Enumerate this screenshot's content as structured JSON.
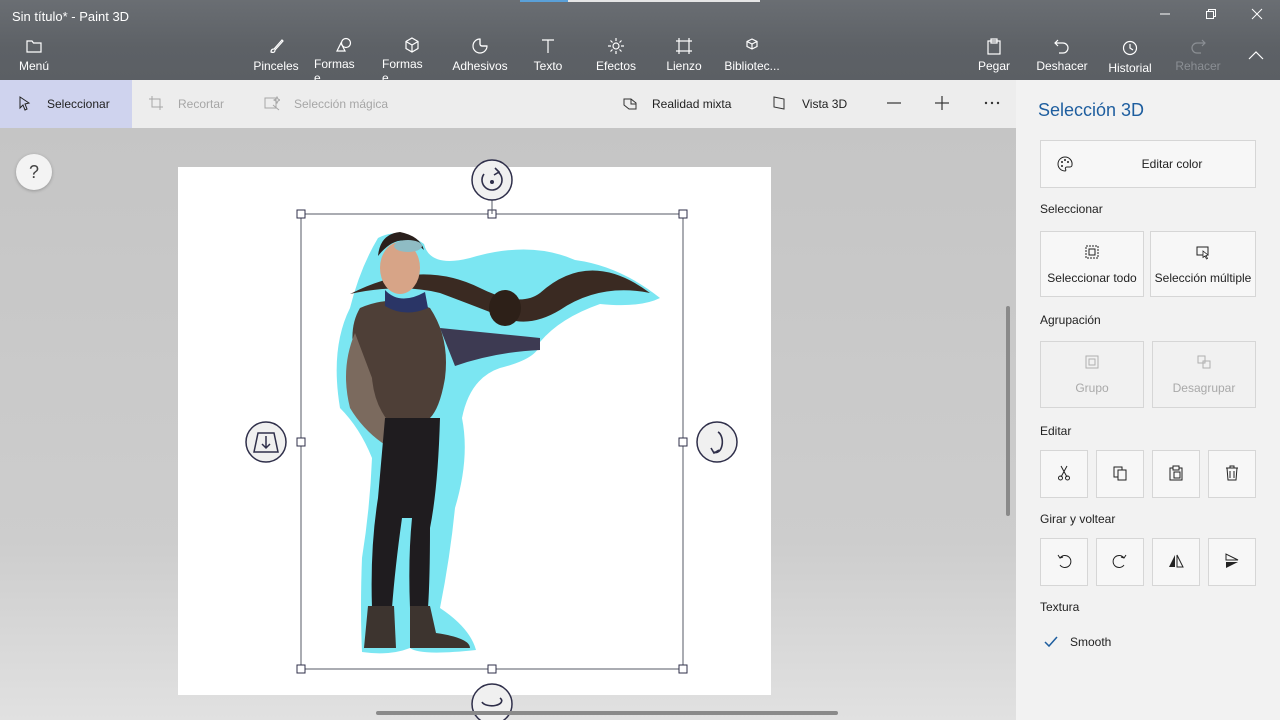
{
  "window": {
    "title": "Sin título* - Paint 3D",
    "minimize_icon": "minimize-icon",
    "maximize_icon": "restore-icon",
    "close_icon": "close-icon"
  },
  "toolbar": {
    "menu": "Menú",
    "brushes": "Pinceles",
    "shapes2d": "Formas e...",
    "shapes3d": "Formas e...",
    "stickers": "Adhesivos",
    "text": "Texto",
    "effects": "Efectos",
    "canvas": "Lienzo",
    "library": "Bibliotec...",
    "paste": "Pegar",
    "undo": "Deshacer",
    "history": "Historial",
    "redo": "Rehacer"
  },
  "subbar": {
    "select": "Seleccionar",
    "crop": "Recortar",
    "magic_select": "Selección mágica",
    "mixed_reality": "Realidad mixta",
    "view3d": "Vista 3D"
  },
  "help": {
    "label": "?"
  },
  "panel": {
    "title": "Selección 3D",
    "edit_color": "Editar color",
    "select_section": "Seleccionar",
    "select_all": "Seleccionar todo",
    "multi_select": "Selección múltiple",
    "group_section": "Agrupación",
    "group": "Grupo",
    "ungroup": "Desagrupar",
    "edit_section": "Editar",
    "rotate_section": "Girar y voltear",
    "texture_section": "Textura",
    "smooth": "Smooth"
  },
  "colors": {
    "accent": "#1e5e9f",
    "select_halo": "#7be6f2",
    "handle": "#2f2f4a"
  }
}
